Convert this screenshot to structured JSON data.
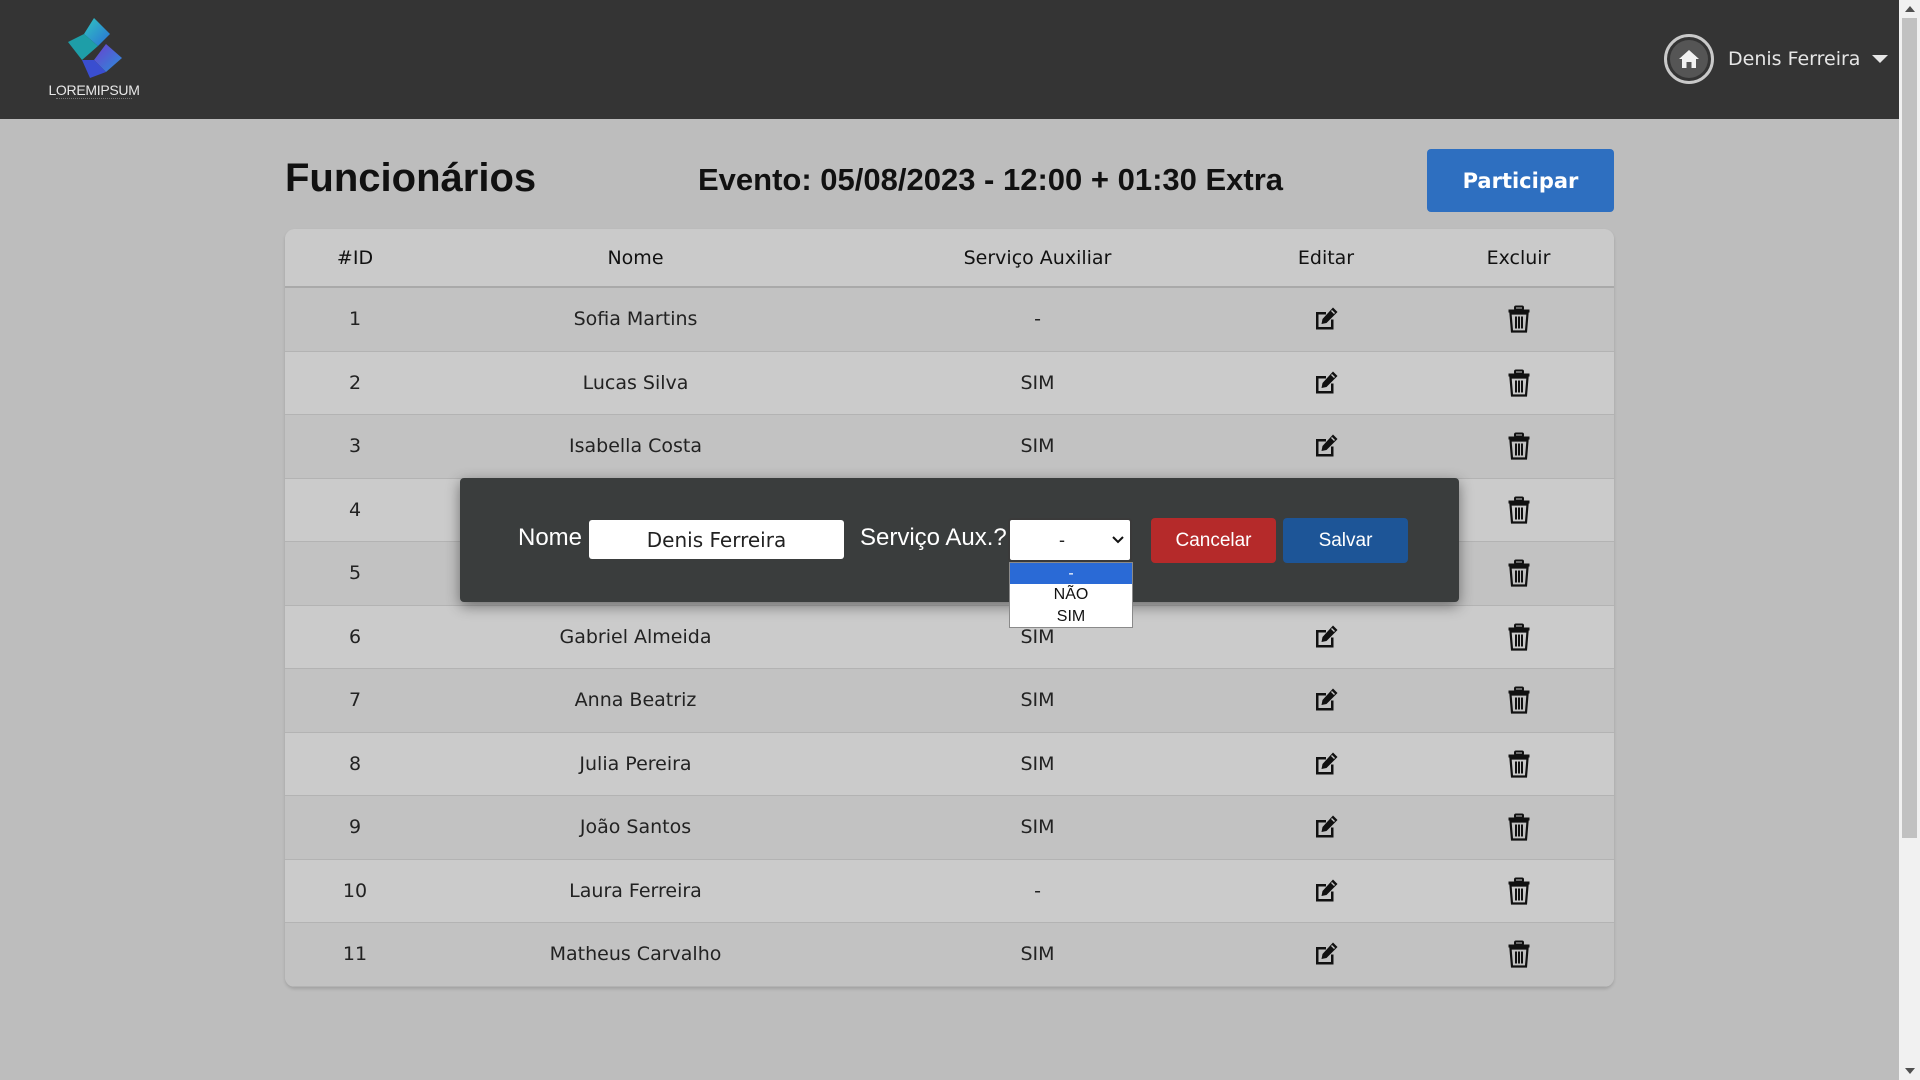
{
  "app": {
    "logo_text": "LOREMIPSUM",
    "user_name": "Denis Ferreira"
  },
  "page": {
    "title": "Funcionários",
    "event": "Evento: 05/08/2023 - 12:00 + 01:30 Extra",
    "participar_label": "Participar"
  },
  "table": {
    "headers": {
      "id": "#ID",
      "nome": "Nome",
      "servico": "Serviço Auxiliar",
      "editar": "Editar",
      "excluir": "Excluir"
    },
    "rows": [
      {
        "id": "1",
        "nome": "Sofia Martins",
        "servico": "-"
      },
      {
        "id": "2",
        "nome": "Lucas Silva",
        "servico": "SIM"
      },
      {
        "id": "3",
        "nome": "Isabella Costa",
        "servico": "SIM"
      },
      {
        "id": "4",
        "nome": "",
        "servico": ""
      },
      {
        "id": "5",
        "nome": "",
        "servico": ""
      },
      {
        "id": "6",
        "nome": "Gabriel Almeida",
        "servico": "SIM"
      },
      {
        "id": "7",
        "nome": "Anna Beatriz",
        "servico": "SIM"
      },
      {
        "id": "8",
        "nome": "Julia Pereira",
        "servico": "SIM"
      },
      {
        "id": "9",
        "nome": "João Santos",
        "servico": "SIM"
      },
      {
        "id": "10",
        "nome": "Laura Ferreira",
        "servico": "-"
      },
      {
        "id": "11",
        "nome": "Matheus Carvalho",
        "servico": "SIM"
      }
    ]
  },
  "modal": {
    "nome_label": "Nome",
    "nome_value": "Denis Ferreira",
    "aux_label": "Serviço Aux.?",
    "aux_selected": "-",
    "aux_options": [
      "-",
      "NÃO",
      "SIM"
    ],
    "cancel_label": "Cancelar",
    "save_label": "Salvar"
  },
  "colors": {
    "header_bg": "#343434",
    "primary": "#2e6fc0",
    "danger": "#b52a2a",
    "save": "#1d5597",
    "modal_bg": "#3a3d3d"
  }
}
